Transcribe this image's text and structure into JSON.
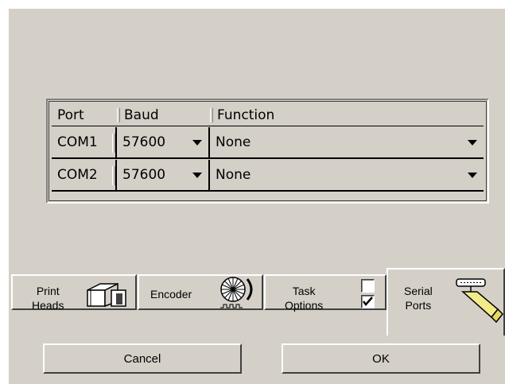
{
  "grid": {
    "headers": {
      "port": "Port",
      "baud": "Baud",
      "function": "Function"
    },
    "rows": [
      {
        "port": "COM1",
        "baud": "57600",
        "function": "None"
      },
      {
        "port": "COM2",
        "baud": "57600",
        "function": "None"
      }
    ]
  },
  "tabs": {
    "print_heads": {
      "line1": "Print",
      "line2": "Heads",
      "icon": "print-head-icon"
    },
    "encoder": {
      "label": "Encoder",
      "icon": "encoder-wheel-icon"
    },
    "task_options": {
      "line1": "Task",
      "line2": "Options",
      "check1": false,
      "check2": true
    },
    "serial_ports": {
      "line1": "Serial",
      "line2": "Ports",
      "icon": "serial-cable-icon",
      "active": true
    }
  },
  "buttons": {
    "cancel": "Cancel",
    "ok": "OK"
  }
}
